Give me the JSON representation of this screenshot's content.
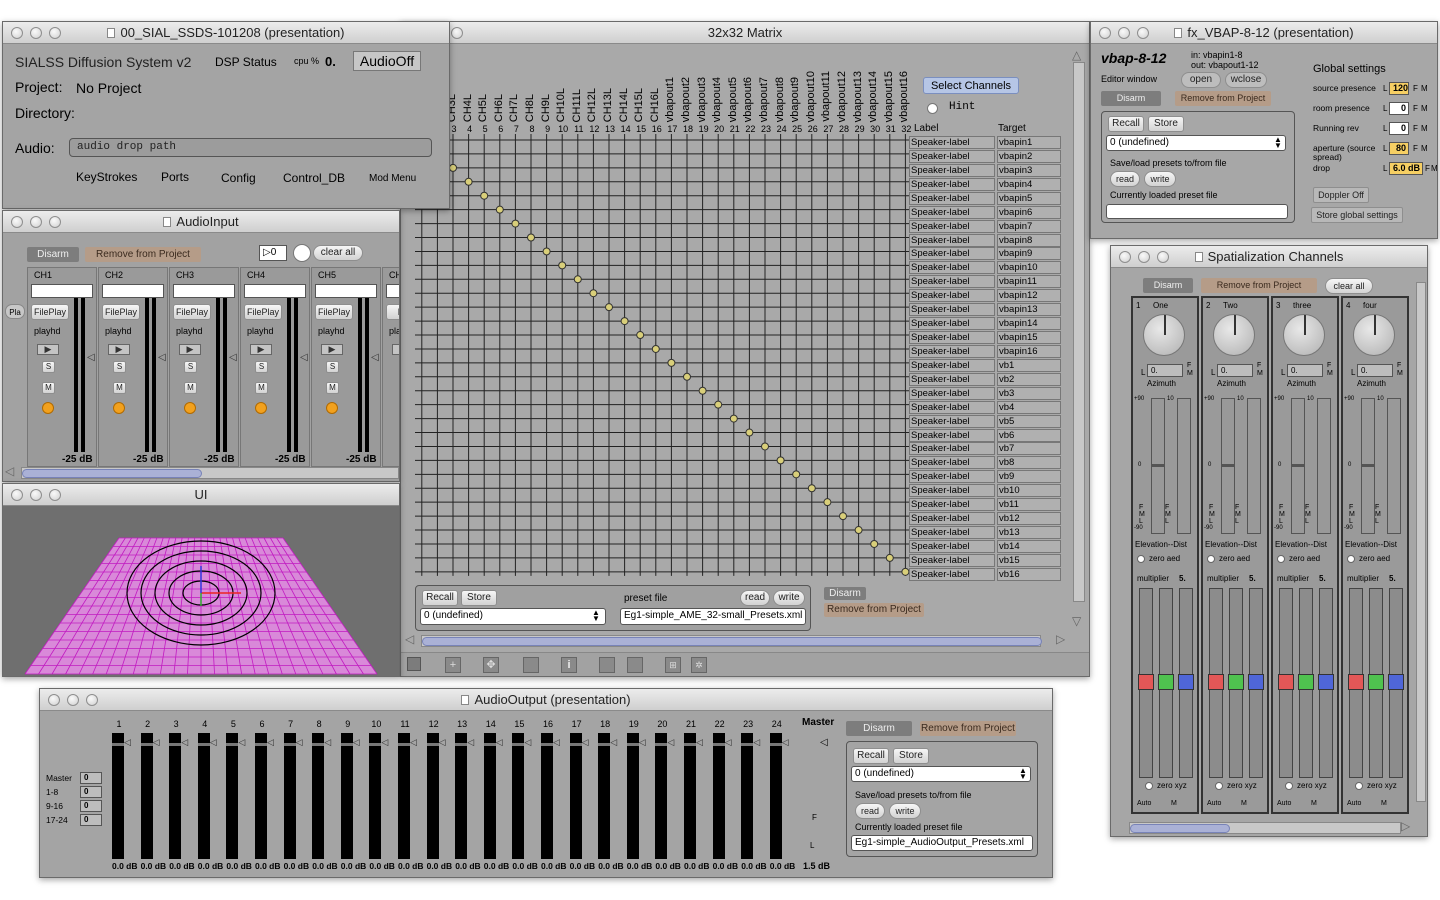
{
  "sialss": {
    "title": "00_SIAL_SSDS-101208 (presentation)",
    "app_name": "SIALSS Diffusion System v2",
    "dsp_label": "DSP Status",
    "cpu_label": "cpu %",
    "cpu_value": "0.",
    "audio_off": "AudioOff",
    "project_label": "Project:",
    "project_value": "No Project",
    "directory_label": "Directory:",
    "audio_label": "Audio:",
    "audio_placeholder": "audio drop path",
    "menu": [
      "KeyStrokes",
      "Ports",
      "Config",
      "Control_DB",
      "Mod Menu"
    ]
  },
  "audio_input": {
    "title": "AudioInput",
    "disarm": "Disarm",
    "remove": "Remove from Project",
    "counter": "0",
    "clear": "clear all",
    "play_label": "Pla",
    "channels": [
      {
        "name": "CH1",
        "fileplay": "FilePlay",
        "playhd": "playhd",
        "s": "S",
        "m": "M",
        "db": "-25 dB"
      },
      {
        "name": "CH2",
        "fileplay": "FilePlay",
        "playhd": "playhd",
        "s": "S",
        "m": "M",
        "db": "-25 dB"
      },
      {
        "name": "CH3",
        "fileplay": "FilePlay",
        "playhd": "playhd",
        "s": "S",
        "m": "M",
        "db": "-25 dB"
      },
      {
        "name": "CH4",
        "fileplay": "FilePlay",
        "playhd": "playhd",
        "s": "S",
        "m": "M",
        "db": "-25 dB"
      },
      {
        "name": "CH5",
        "fileplay": "FilePlay",
        "playhd": "playhd",
        "s": "S",
        "m": "M",
        "db": "-25 dB"
      },
      {
        "name": "CH",
        "fileplay": "File",
        "playhd": "pla",
        "s": "",
        "m": "",
        "db": ""
      }
    ]
  },
  "ui": {
    "title": "UI"
  },
  "matrix": {
    "title": "32x32 Matrix",
    "select_channels": "Select Channels",
    "hint": "Hint",
    "label_header": "Label",
    "target_header": "Target",
    "col_labels": [
      "CH3L",
      "CH4L",
      "CH5L",
      "CH6L",
      "CH7L",
      "CH8L",
      "CH9L",
      "CH10L",
      "CH11L",
      "CH12L",
      "CH13L",
      "CH14L",
      "CH15L",
      "CH16L",
      "vbapout1",
      "vbapout2",
      "vbapout3",
      "vbapout4",
      "vbapout5",
      "vbapout6",
      "vbapout7",
      "vbapout8",
      "vbapout9",
      "vbapout10",
      "vbapout11",
      "vbapout12",
      "vbapout13",
      "vbapout14",
      "vbapout15",
      "vbapout16"
    ],
    "col_numbers": [
      "3",
      "4",
      "5",
      "6",
      "7",
      "8",
      "9",
      "10",
      "11",
      "12",
      "13",
      "14",
      "15",
      "16",
      "17",
      "18",
      "19",
      "20",
      "21",
      "22",
      "23",
      "24",
      "25",
      "26",
      "27",
      "28",
      "29",
      "30",
      "31",
      "32"
    ],
    "rows": [
      {
        "label": "Speaker-label",
        "target": "vbapin1"
      },
      {
        "label": "Speaker-label",
        "target": "vbapin2"
      },
      {
        "label": "Speaker-label",
        "target": "vbapin3"
      },
      {
        "label": "Speaker-label",
        "target": "vbapin4"
      },
      {
        "label": "Speaker-label",
        "target": "vbapin5"
      },
      {
        "label": "Speaker-label",
        "target": "vbapin6"
      },
      {
        "label": "Speaker-label",
        "target": "vbapin7"
      },
      {
        "label": "Speaker-label",
        "target": "vbapin8"
      },
      {
        "label": "Speaker-label",
        "target": "vbapin9"
      },
      {
        "label": "Speaker-label",
        "target": "vbapin10"
      },
      {
        "label": "Speaker-label",
        "target": "vbapin11"
      },
      {
        "label": "Speaker-label",
        "target": "vbapin12"
      },
      {
        "label": "Speaker-label",
        "target": "vbapin13"
      },
      {
        "label": "Speaker-label",
        "target": "vbapin14"
      },
      {
        "label": "Speaker-label",
        "target": "vbapin15"
      },
      {
        "label": "Speaker-label",
        "target": "vbapin16"
      },
      {
        "label": "Speaker-label",
        "target": "vb1"
      },
      {
        "label": "Speaker-label",
        "target": "vb2"
      },
      {
        "label": "Speaker-label",
        "target": "vb3"
      },
      {
        "label": "Speaker-label",
        "target": "vb4"
      },
      {
        "label": "Speaker-label",
        "target": "vb5"
      },
      {
        "label": "Speaker-label",
        "target": "vb6"
      },
      {
        "label": "Speaker-label",
        "target": "vb7"
      },
      {
        "label": "Speaker-label",
        "target": "vb8"
      },
      {
        "label": "Speaker-label",
        "target": "vb9"
      },
      {
        "label": "Speaker-label",
        "target": "vb10"
      },
      {
        "label": "Speaker-label",
        "target": "vb11"
      },
      {
        "label": "Speaker-label",
        "target": "vb12"
      },
      {
        "label": "Speaker-label",
        "target": "vb13"
      },
      {
        "label": "Speaker-label",
        "target": "vb14"
      },
      {
        "label": "Speaker-label",
        "target": "vb15"
      },
      {
        "label": "Speaker-label",
        "target": "vb16"
      }
    ],
    "recall": "Recall",
    "store": "Store",
    "preset_label": "preset file",
    "read": "read",
    "write": "write",
    "preset_select": "0 (undefined)",
    "preset_file": "Eg1-simple_AME_32-small_Presets.xml",
    "disarm": "Disarm",
    "remove": "Remove from Project"
  },
  "vbap": {
    "title": "fx_VBAP-8-12 (presentation)",
    "name": "vbap-8-12",
    "io_in": "in: vbapin1-8",
    "io_out": "out: vbapout1-12",
    "editor": "Editor window",
    "open": "open",
    "wclose": "wclose",
    "disarm": "Disarm",
    "remove": "Remove from Project",
    "recall": "Recall",
    "store": "Store",
    "preset_select": "0 (undefined)",
    "save_load": "Save/load presets to/from file",
    "read": "read",
    "write": "write",
    "loaded": "Currently loaded preset file",
    "global": "Global settings",
    "settings": [
      {
        "label": "source presence",
        "value": "120",
        "hl": true
      },
      {
        "label": "room presence",
        "value": "0",
        "hl": false
      },
      {
        "label": "Running rev",
        "value": "0",
        "hl": false
      },
      {
        "label": "aperture (source spread)",
        "value": "80",
        "hl": true
      },
      {
        "label": "drop",
        "value": "6.0 dB",
        "hl": true
      }
    ],
    "l": "L",
    "f": "F",
    "m": "M",
    "doppler": "Doppler Off",
    "store_global": "Store global settings"
  },
  "spat": {
    "title": "Spatialization Channels",
    "disarm": "Disarm",
    "remove": "Remove from Project",
    "clear": "clear all",
    "channels": [
      {
        "num": "1",
        "name": "One"
      },
      {
        "num": "2",
        "name": "Two"
      },
      {
        "num": "3",
        "name": "three"
      },
      {
        "num": "4",
        "name": "four"
      }
    ],
    "az_value": "0.",
    "l": "L",
    "f": "F",
    "m": "M",
    "azimuth": "Azimuth",
    "plus90": "+90",
    "minus90": "-90",
    "ten": "10",
    "zero": "0",
    "elev": "Elevation--Dist",
    "zero_aed": "zero aed",
    "multiplier": "multiplier",
    "mult_value": "5.",
    "zero_xyz": "zero xyz",
    "auto": "Auto"
  },
  "audio_output": {
    "title": "AudioOutput (presentation)",
    "channels": [
      "1",
      "2",
      "3",
      "4",
      "5",
      "6",
      "7",
      "8",
      "9",
      "10",
      "11",
      "12",
      "13",
      "14",
      "15",
      "16",
      "17",
      "18",
      "19",
      "20",
      "21",
      "22",
      "23",
      "24"
    ],
    "master": "Master",
    "db": "0.0 dB",
    "master_db": "1.5 dB",
    "groups": [
      {
        "label": "Master",
        "value": "0"
      },
      {
        "label": "1-8",
        "value": "0"
      },
      {
        "label": "9-16",
        "value": "0"
      },
      {
        "label": "17-24",
        "value": "0"
      }
    ],
    "disarm": "Disarm",
    "remove": "Remove from Project",
    "recall": "Recall",
    "store": "Store",
    "preset_select": "0 (undefined)",
    "save_load": "Save/load presets to/from file",
    "read": "read",
    "write": "write",
    "loaded": "Currently loaded preset file",
    "file": "Eg1-simple_AudioOutput_Presets.xml",
    "f": "F",
    "l": "L"
  }
}
